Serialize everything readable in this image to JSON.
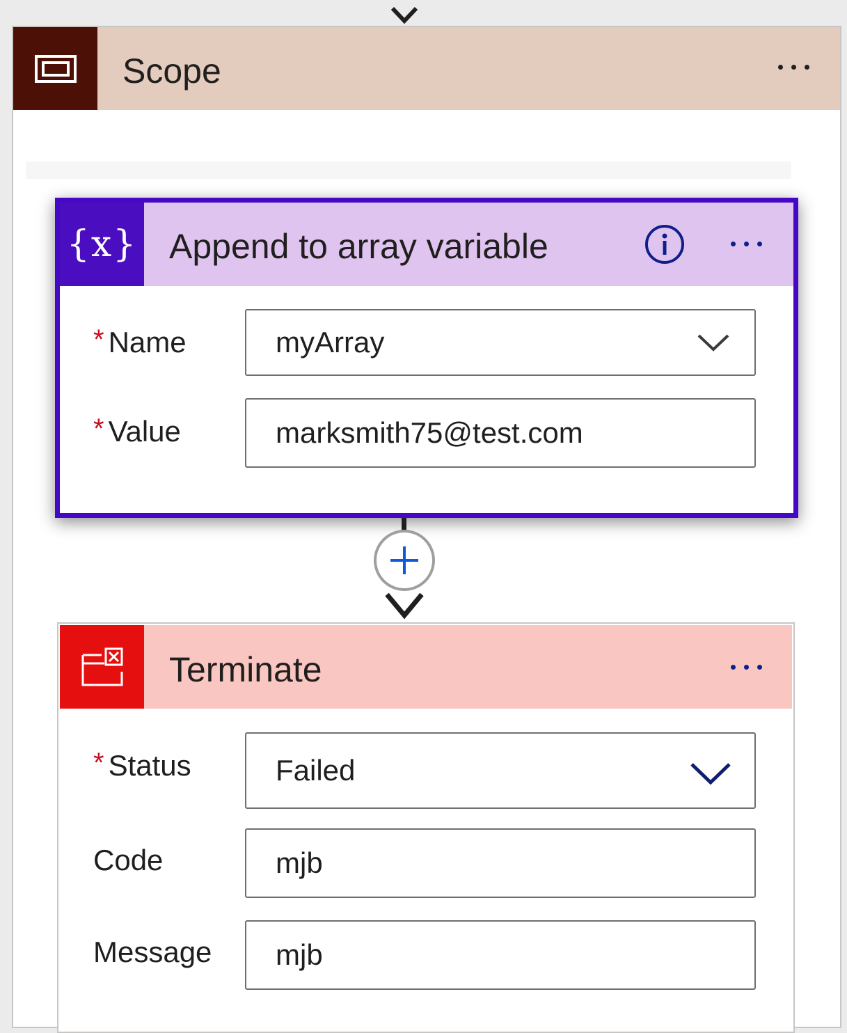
{
  "scope": {
    "title": "Scope",
    "icon": "scope-icon",
    "colors": {
      "header": "#e3cbbd",
      "icon_bg": "#4d1006"
    }
  },
  "append": {
    "title": "Append to array variable",
    "icon": "variable-icon",
    "icon_glyph": "{x}",
    "colors": {
      "header": "#e0c4f0",
      "icon_bg": "#4a0dbf",
      "border": "#4509c5"
    },
    "fields": {
      "name": {
        "label": "Name",
        "required_mark": "*",
        "value": "myArray"
      },
      "value": {
        "label": "Value",
        "required_mark": "*",
        "value": "marksmith75@test.com"
      }
    }
  },
  "terminate": {
    "title": "Terminate",
    "icon": "terminate-icon",
    "colors": {
      "header": "#f9c6c2",
      "icon_bg": "#e50f0f"
    },
    "fields": {
      "status": {
        "label": "Status",
        "required_mark": "*",
        "value": "Failed"
      },
      "code": {
        "label": "Code",
        "value": "mjb"
      },
      "message": {
        "label": "Message",
        "value": "mjb"
      }
    }
  }
}
